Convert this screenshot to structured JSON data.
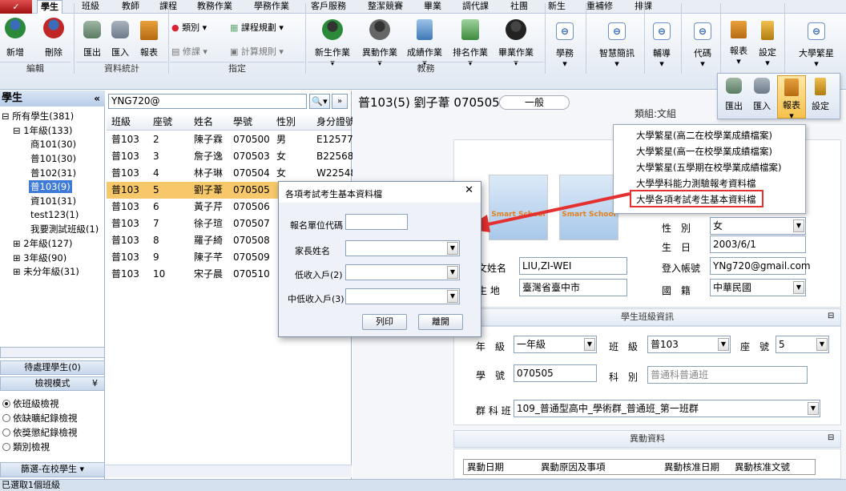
{
  "app_button": "✓",
  "menu_tabs": [
    "學生",
    "班級",
    "教師",
    "課程",
    "教務作業",
    "學務作業",
    "客戶服務",
    "整潔競賽",
    "畢業",
    "調代課",
    "社團",
    "新生",
    "重補修",
    "排課"
  ],
  "ribbon": {
    "add": "新增",
    "delete": "刪除",
    "edit_group": "編輯",
    "export": "匯出",
    "import": "匯入",
    "report": "報表",
    "data_group": "資料統計",
    "category": "類別",
    "course_plan": "課程規劃",
    "repair": "修課",
    "calc_rule": "計算規則",
    "assign_group": "指定",
    "newstudent": "新生作業",
    "transfer": "異動作業",
    "grade": "成績作業",
    "rank": "排名作業",
    "graduate": "畢業作業",
    "academic_group": "教務",
    "studentaffairs": "學務",
    "smart": "智慧簡訊",
    "counsel": "輔導",
    "code": "代碼",
    "report2": "報表",
    "settings": "設定",
    "star": "大學繁星"
  },
  "left": {
    "title": "學生",
    "collapse": "«",
    "tree": [
      "所有學生(381)",
      "1年級(133)",
      "商101(30)",
      "普101(30)",
      "普102(31)",
      "普103(9)",
      "資101(31)",
      "test123(1)",
      "我要測試班級(1)",
      "2年級(127)",
      "3年級(90)",
      "未分年級(31)"
    ],
    "pending": "待處理學生(0)",
    "view_mode": "檢視模式",
    "views": [
      "依班級檢視",
      "依缺曠紀錄檢視",
      "依獎懲紀錄檢視",
      "類別檢視"
    ],
    "filter": "篩選-在校學生"
  },
  "search": {
    "value": "YNG720@"
  },
  "list": {
    "headers": [
      "班級",
      "座號",
      "姓名",
      "學號",
      "性別",
      "身分證號"
    ],
    "rows": [
      [
        "普103",
        "2",
        "陳子霖",
        "070500",
        "男",
        "E12577"
      ],
      [
        "普103",
        "3",
        "詹子逸",
        "070503",
        "女",
        "B22568"
      ],
      [
        "普103",
        "4",
        "林子琳",
        "070504",
        "女",
        "W22548"
      ],
      [
        "普103",
        "5",
        "劉子葦",
        "070505",
        "",
        ""
      ],
      [
        "普103",
        "6",
        "黃子芹",
        "070506",
        "",
        ""
      ],
      [
        "普103",
        "7",
        "徐子瑄",
        "070507",
        "",
        ""
      ],
      [
        "普103",
        "8",
        "羅子綺",
        "070508",
        "",
        ""
      ],
      [
        "普103",
        "9",
        "陳子芊",
        "070509",
        "",
        ""
      ],
      [
        "普103",
        "10",
        "宋子晨",
        "070510",
        "",
        ""
      ]
    ]
  },
  "detail": {
    "title": "普103(5) 劉子葦 070505",
    "status": "一般",
    "category_label": "類組:文組",
    "gender_label": "性　別",
    "gender": "女",
    "birth_label": "生　日",
    "birth": "2003/6/1",
    "en_name_label": "文姓名",
    "en_name": "LIU,ZI-WEI",
    "login_label": "登入帳號",
    "login": "YNg720@gmail.com",
    "birthplace_label": "生 地",
    "birthplace": "臺灣省臺中市",
    "nation_label": "國　籍",
    "nation": "中華民國",
    "class_section": "學生班級資訊",
    "grade_label": "年　級",
    "grade": "一年級",
    "class_label": "班　級",
    "class": "普103",
    "seat_label": "座　號",
    "seat": "5",
    "stuno_label": "學　號",
    "stuno": "070505",
    "dept_label": "科　別",
    "dept": "普通科普通班",
    "group_label": "群 科 班",
    "group": "109_普通型高中_學術群_普通班_第一班群",
    "transfer_section": "異動資料",
    "transfer_headers": [
      "異動日期",
      "異動原因及事項",
      "異動核准日期",
      "異動核准文號"
    ],
    "photo_text": "Smart School"
  },
  "dialog": {
    "title": "各項考試考生基本資料檔",
    "close": "✕",
    "fields": [
      "報名單位代碼",
      "家長姓名",
      "低收入戶(2)",
      "中低收入戶(3)"
    ],
    "print": "列印",
    "leave": "離開"
  },
  "popup": {
    "small_buttons": [
      "匯出",
      "匯入",
      "報表",
      "設定"
    ],
    "items": [
      "大學繁星(高二在校學業成績檔案)",
      "大學繁星(高一在校學業成績檔案)",
      "大學繁星(五學期在校學業成績檔案)",
      "大學學科能力測驗報考資料檔",
      "大學各項考試考生基本資料檔"
    ]
  },
  "status": "已選取1個班級",
  "colors": {
    "highlight": "#f7c86a",
    "selected": "#cfe0f6",
    "arrow": "#e53030"
  }
}
